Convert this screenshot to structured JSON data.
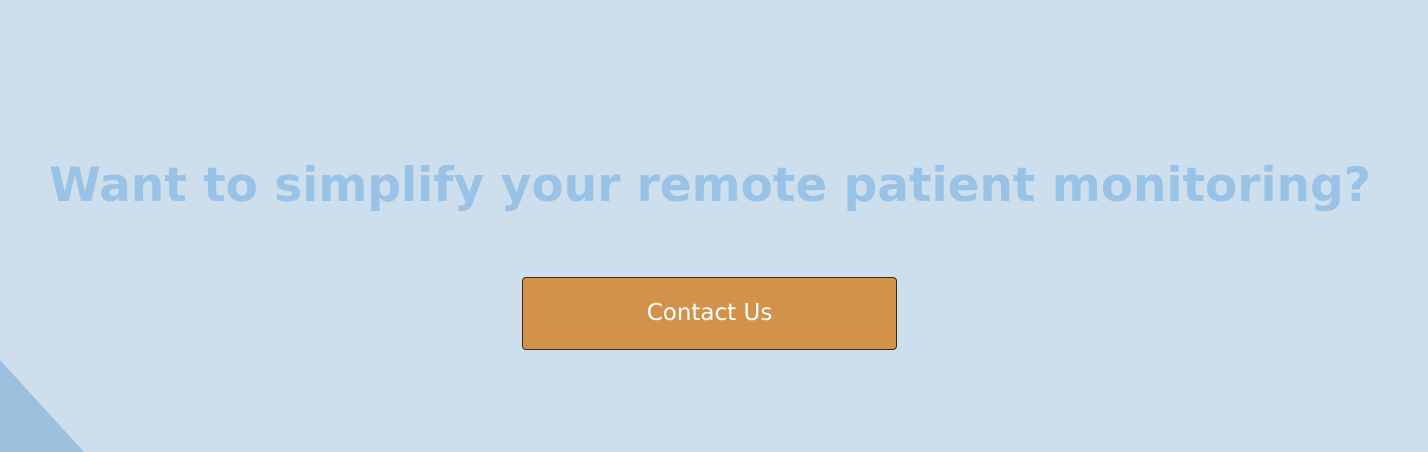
{
  "cta": {
    "heading": "Want to simplify your remote patient monitoring?",
    "button_label": "Contact Us"
  },
  "colors": {
    "background": "#cddfed",
    "heading": "#99c3e6",
    "button": "#d3924a",
    "button_text": "#ffffff",
    "corner_shape": "#9bbfdc"
  }
}
